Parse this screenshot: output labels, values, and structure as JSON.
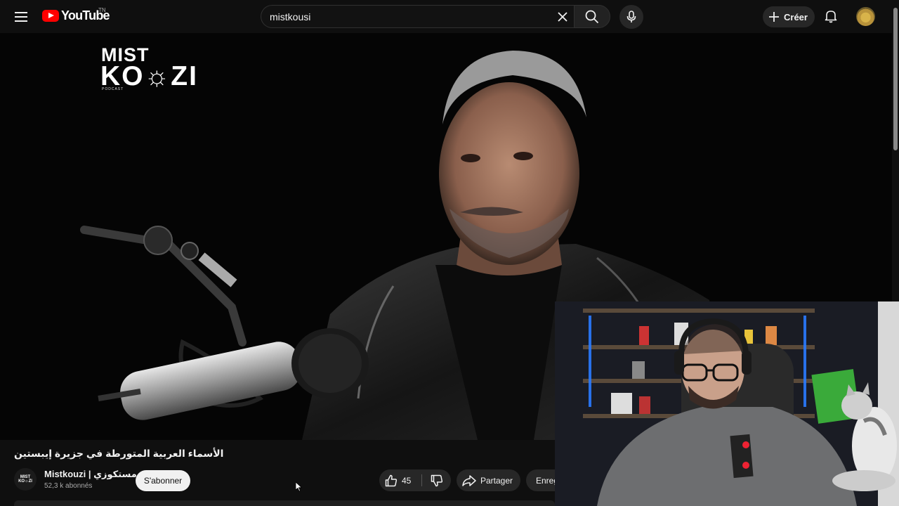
{
  "header": {
    "logo_text": "YouTube",
    "country_code": "TN",
    "search_value": "mistkousi",
    "create_label": "Créer"
  },
  "video": {
    "brand_top": "MIST",
    "brand_bottom": "KO☼ZI",
    "brand_sub": "PODCAST",
    "title": "الأسماء العربية المتورطة في جزيرة إيبستين"
  },
  "channel": {
    "avatar_text_line1": "MIST",
    "avatar_text_line2": "KO☼ZI",
    "name": "Mistkouzi | مستكوزي",
    "subscribers": "52,3 k abonnés",
    "subscribe_label": "S'abonner"
  },
  "actions": {
    "like_count": "45",
    "share_label": "Partager",
    "save_label": "Enregistrer"
  },
  "icons": {
    "menu": "menu-icon",
    "search": "search-icon",
    "clear": "close-icon",
    "mic": "mic-icon",
    "create": "plus-icon",
    "notifications": "bell-icon",
    "like": "thumbs-up-icon",
    "dislike": "thumbs-down-icon",
    "share": "share-icon",
    "save": "bookmark-icon"
  },
  "colors": {
    "background": "#0f0f0f",
    "brand_red": "#ff0000",
    "button_bg": "#272727"
  }
}
